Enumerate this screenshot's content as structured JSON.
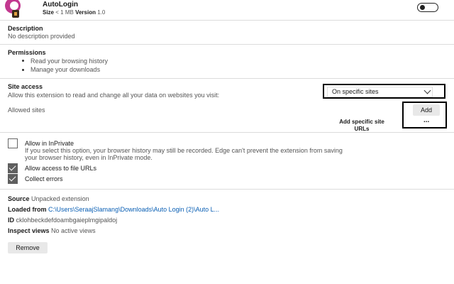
{
  "header": {
    "name": "AutoLogin",
    "size_label": "Size",
    "size_value": "< 1 MB",
    "version_label": "Version",
    "version_value": "1.0",
    "enabled": false
  },
  "description": {
    "title": "Description",
    "text": "No description provided"
  },
  "permissions": {
    "title": "Permissions",
    "items": [
      "Read your browsing history",
      "Manage your downloads"
    ]
  },
  "site_access": {
    "title": "Site access",
    "text": "Allow this extension to read and change all your data on websites you visit:",
    "selected": "On specific sites",
    "allowed_sites_label": "Allowed sites",
    "add_label": "Add",
    "add_specific_line1": "Add specific site",
    "add_specific_line2": "URLs",
    "more_label": "..."
  },
  "options": {
    "inprivate": {
      "label": "Allow in InPrivate",
      "checked": false,
      "desc_line1": "If you select this option, your browser history may still be recorded. Edge can't prevent the extension from saving",
      "desc_line2": "your browser history, even in InPrivate mode."
    },
    "file_urls": {
      "label": "Allow access to file URLs",
      "checked": true
    },
    "collect_errors": {
      "label": "Collect errors",
      "checked": true
    }
  },
  "details": {
    "source_label": "Source",
    "source_value": "Unpacked extension",
    "loaded_label": "Loaded from",
    "loaded_value": "C:\\Users\\SeraajSlamang\\Downloads\\Auto Login (2)\\Auto L...",
    "id_label": "ID",
    "id_value": "cklohbeckdefdoambgaieplmgipaldoj",
    "inspect_label": "Inspect views",
    "inspect_value": "No active views"
  },
  "remove_label": "Remove",
  "colors": {
    "link": "#0a5fb4",
    "divider": "#dcdcdc",
    "checkbox_on": "#5f5f5f"
  }
}
